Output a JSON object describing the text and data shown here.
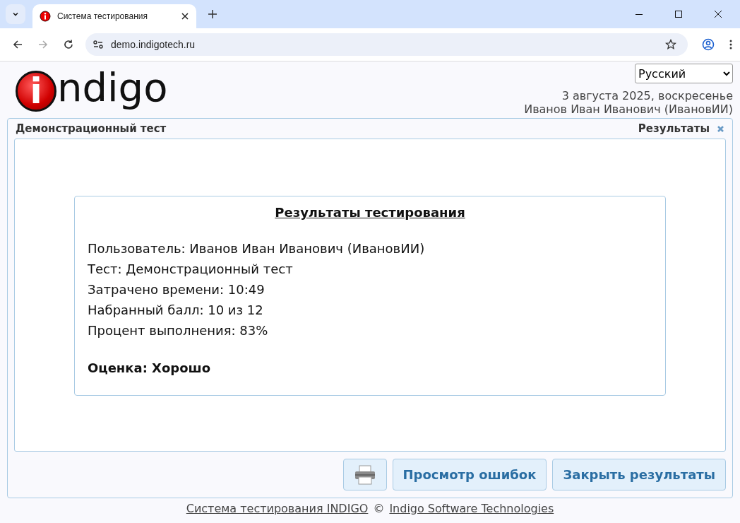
{
  "browser": {
    "tab_title": "Система тестирования",
    "url": "demo.indigotech.ru"
  },
  "header": {
    "logo": {
      "mark": "i",
      "text": "ndigo"
    },
    "language": "Русский",
    "date": "3 августа 2025, воскресенье",
    "user": "Иванов Иван Иванович (ИвановИИ)"
  },
  "panel": {
    "title": "Демонстрационный тест",
    "section": "Результаты"
  },
  "results": {
    "title": "Результаты тестирования",
    "lines": [
      "Пользователь: Иванов Иван Иванович (ИвановИИ)",
      "Тест: Демонстрационный тест",
      "Затрачено времени: 10:49",
      "Набранный балл: 10 из 12",
      "Процент выполнения: 83%"
    ],
    "grade": "Оценка: Хорошо"
  },
  "buttons": [
    "Просмотр ошибок",
    "Закрыть результаты"
  ],
  "footer": {
    "link_1": "Система тестирования INDIGO",
    "separator": "©",
    "link_2": "Indigo Software Technologies"
  }
}
